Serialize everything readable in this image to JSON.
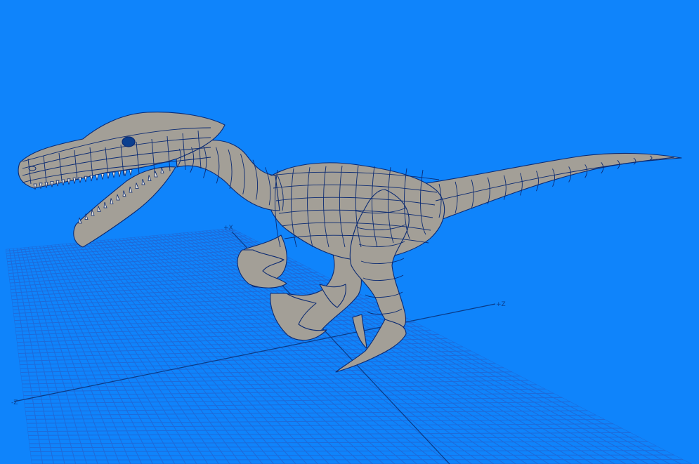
{
  "viewport": {
    "background_color": "#0f84fb",
    "grid_color": "#1f6ad8",
    "axis_color": "#0a3a86",
    "mesh_fill_color": "#a39f97",
    "wire_color": "#0b2a72"
  },
  "axes": {
    "x_plus_label": "+X",
    "z_plus_label": "+Z",
    "z_minus_label": "-Z"
  }
}
